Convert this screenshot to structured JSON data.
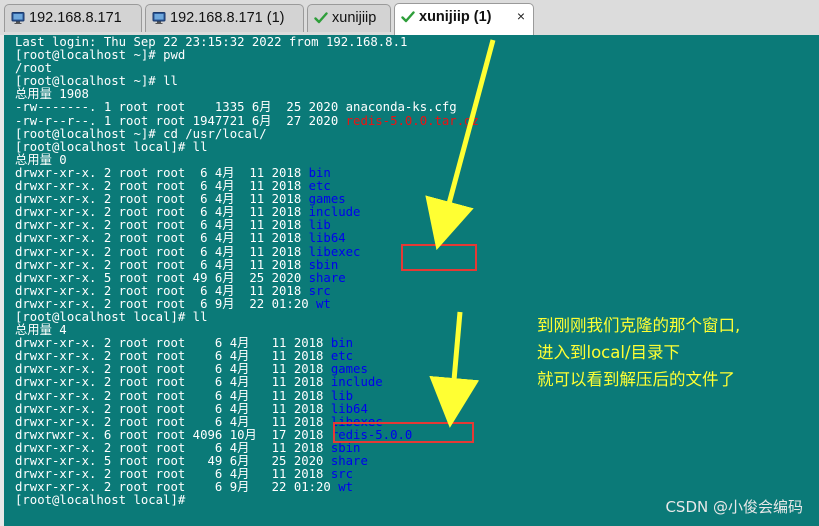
{
  "tabs": [
    {
      "label": "192.168.8.171",
      "icon": "monitor-icon",
      "active": false
    },
    {
      "label": "192.168.8.171 (1)",
      "icon": "monitor-icon",
      "active": false
    },
    {
      "label": "xunijiip",
      "icon": "checkmark-icon",
      "active": false
    },
    {
      "label": "xunijiip (1)",
      "icon": "checkmark-icon",
      "active": true
    }
  ],
  "tab_close_glyph": "×",
  "colors": {
    "terminal_bg": "#0b7a78",
    "dir_text": "#0000ee",
    "archive_text": "#ee1111",
    "annotation": "#ffff33",
    "highlight_box": "#e53935"
  },
  "terminal": {
    "lines": [
      {
        "text": "Last login: Thu Sep 22 23:15:32 2022 from 192.168.8.1"
      },
      {
        "text": "[root@localhost ~]# pwd"
      },
      {
        "text": "/root"
      },
      {
        "text": "[root@localhost ~]# ll"
      },
      {
        "text": "总用量 1908"
      },
      {
        "text": "-rw-------. 1 root root    1335 6月  25 2020 ",
        "name": "anaconda-ks.cfg"
      },
      {
        "text": "-rw-r--r--. 1 root root 1947721 6月  27 2020 ",
        "name": "redis-5.0.0.tar.gz",
        "style": "red"
      },
      {
        "text": "[root@localhost ~]# cd /usr/local/"
      },
      {
        "text": "[root@localhost local]# ll"
      },
      {
        "text": "总用量 0"
      },
      {
        "text": "drwxr-xr-x. 2 root root  6 4月  11 2018 ",
        "name": "bin",
        "style": "blue"
      },
      {
        "text": "drwxr-xr-x. 2 root root  6 4月  11 2018 ",
        "name": "etc",
        "style": "blue"
      },
      {
        "text": "drwxr-xr-x. 2 root root  6 4月  11 2018 ",
        "name": "games",
        "style": "blue"
      },
      {
        "text": "drwxr-xr-x. 2 root root  6 4月  11 2018 ",
        "name": "include",
        "style": "blue"
      },
      {
        "text": "drwxr-xr-x. 2 root root  6 4月  11 2018 ",
        "name": "lib",
        "style": "blue"
      },
      {
        "text": "drwxr-xr-x. 2 root root  6 4月  11 2018 ",
        "name": "lib64",
        "style": "blue"
      },
      {
        "text": "drwxr-xr-x. 2 root root  6 4月  11 2018 ",
        "name": "libexec",
        "style": "blue"
      },
      {
        "text": "drwxr-xr-x. 2 root root  6 4月  11 2018 ",
        "name": "sbin",
        "style": "blue"
      },
      {
        "text": "drwxr-xr-x. 5 root root 49 6月  25 2020 ",
        "name": "share",
        "style": "blue"
      },
      {
        "text": "drwxr-xr-x. 2 root root  6 4月  11 2018 ",
        "name": "src",
        "style": "blue"
      },
      {
        "text": "drwxr-xr-x. 2 root root  6 9月  22 01:20 ",
        "name": "wt",
        "style": "blue"
      },
      {
        "text": "[root@localhost local]# ll"
      },
      {
        "text": "总用量 4"
      },
      {
        "text": "drwxr-xr-x. 2 root root    6 4月   11 2018 ",
        "name": "bin",
        "style": "blue"
      },
      {
        "text": "drwxr-xr-x. 2 root root    6 4月   11 2018 ",
        "name": "etc",
        "style": "blue"
      },
      {
        "text": "drwxr-xr-x. 2 root root    6 4月   11 2018 ",
        "name": "games",
        "style": "blue"
      },
      {
        "text": "drwxr-xr-x. 2 root root    6 4月   11 2018 ",
        "name": "include",
        "style": "blue"
      },
      {
        "text": "drwxr-xr-x. 2 root root    6 4月   11 2018 ",
        "name": "lib",
        "style": "blue"
      },
      {
        "text": "drwxr-xr-x. 2 root root    6 4月   11 2018 ",
        "name": "lib64",
        "style": "blue"
      },
      {
        "text": "drwxr-xr-x. 2 root root    6 4月   11 2018 ",
        "name": "libexec",
        "style": "blue"
      },
      {
        "text": "drwxrwxr-x. 6 root root 4096 10月  17 2018 ",
        "name": "redis-5.0.0",
        "style": "blue"
      },
      {
        "text": "drwxr-xr-x. 2 root root    6 4月   11 2018 ",
        "name": "sbin",
        "style": "blue"
      },
      {
        "text": "drwxr-xr-x. 5 root root   49 6月   25 2020 ",
        "name": "share",
        "style": "blue"
      },
      {
        "text": "drwxr-xr-x. 2 root root    6 4月   11 2018 ",
        "name": "src",
        "style": "blue"
      },
      {
        "text": "drwxr-xr-x. 2 root root    6 9月   22 01:20 ",
        "name": "wt",
        "style": "blue"
      },
      {
        "text": "[root@localhost local]# "
      }
    ]
  },
  "annotation": {
    "lines": [
      "到刚刚我们克隆的那个窗口,",
      "进入到local/目录下",
      "就可以看到解压后的文件了"
    ]
  },
  "watermark": "CSDN @小俊会编码"
}
